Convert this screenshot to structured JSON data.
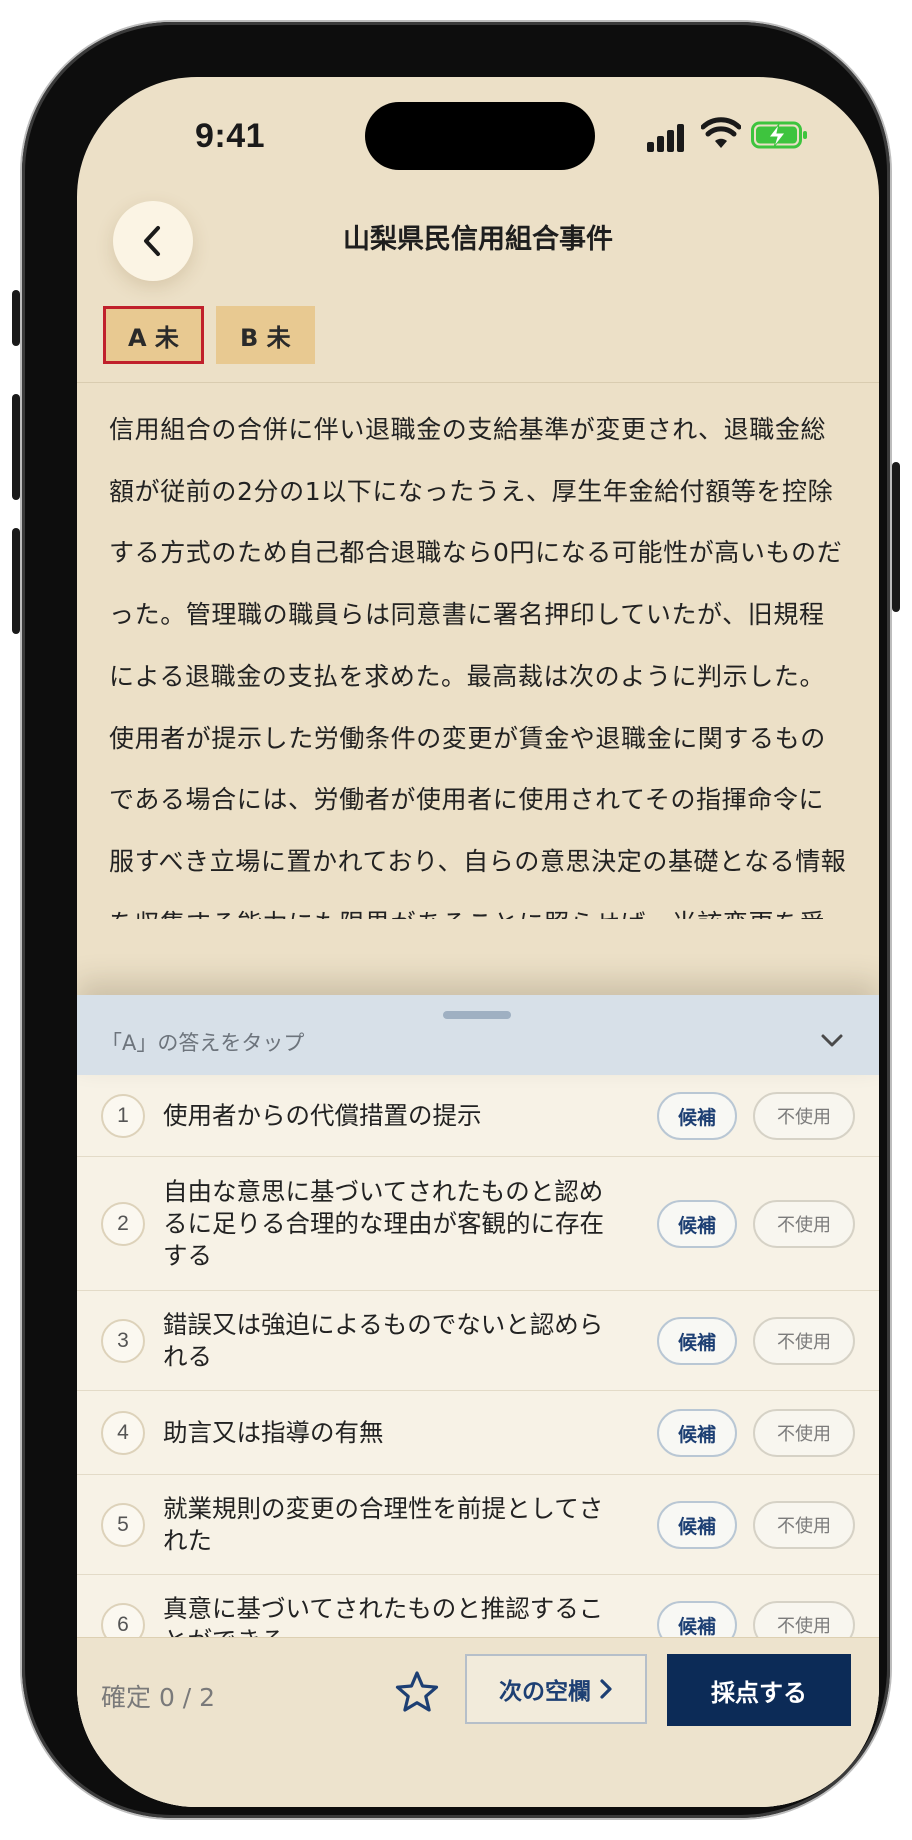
{
  "status_bar": {
    "time": "9:41"
  },
  "header": {
    "title": "山梨県民信用組合事件"
  },
  "tabs": [
    {
      "label": "A 未",
      "selected": true
    },
    {
      "label": "B 未",
      "selected": false
    }
  ],
  "passage": "信用組合の合併に伴い退職金の支給基準が変更され、退職金総額が従前の2分の1以下になったうえ、厚生年金給付額等を控除する方式のため自己都合退職なら0円になる可能性が高いものだった。管理職の職員らは同意書に署名押印していたが、旧規程による退職金の支払を求めた。最高裁は次のように判示した。使用者が提示した労働条件の変更が賃金や退職金に関するものである場合には、労働者が使用者に使用されてその指揮命令に服すべき立場に置かれており、自らの意思決定の基礎となる情報を収集する能力にも限界があることに照らせば、当該変更を受け入れる旨の労働者の行為がある",
  "sheet": {
    "prompt": "「A」の答えをタップ",
    "choices": [
      {
        "num": "1",
        "text": "使用者からの代償措置の提示",
        "candidate_label": "候補",
        "unused_label": "不使用"
      },
      {
        "num": "2",
        "text": "自由な意思に基づいてされたものと認めるに足りる合理的な理由が客観的に存在する",
        "candidate_label": "候補",
        "unused_label": "不使用"
      },
      {
        "num": "3",
        "text": "錯誤又は強迫によるものでないと認められる",
        "candidate_label": "候補",
        "unused_label": "不使用"
      },
      {
        "num": "4",
        "text": "助言又は指導の有無",
        "candidate_label": "候補",
        "unused_label": "不使用"
      },
      {
        "num": "5",
        "text": "就業規則の変更の合理性を前提としてされた",
        "candidate_label": "候補",
        "unused_label": "不使用"
      },
      {
        "num": "6",
        "text": "真意に基づいてされたものと推認することができる",
        "candidate_label": "候補",
        "unused_label": "不使用"
      }
    ]
  },
  "footer": {
    "confirmed_label": "確定 0 / 2",
    "next_label": "次の空欄",
    "grade_label": "採点する"
  },
  "colors": {
    "accent_navy": "#0c2b57",
    "tab_fill": "#e8c991",
    "selected_tab_border": "#c0202b",
    "battery_green": "#3ec43e"
  }
}
